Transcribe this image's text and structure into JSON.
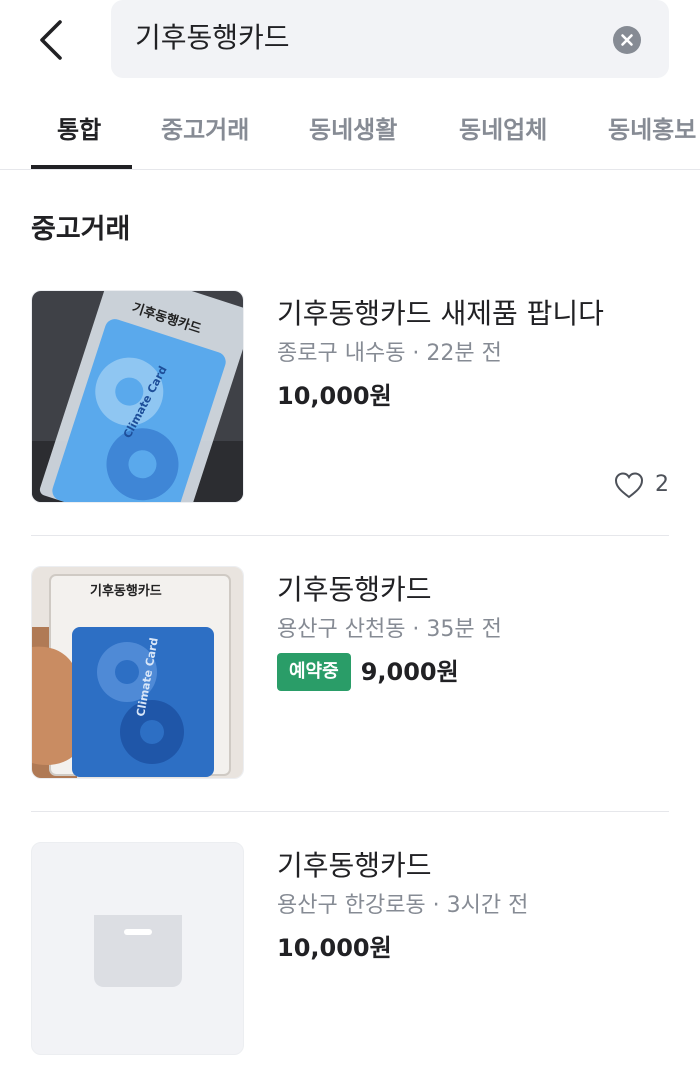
{
  "search": {
    "query": "기후동행카드"
  },
  "tabs": [
    {
      "label": "통합",
      "active": true
    },
    {
      "label": "중고거래",
      "active": false
    },
    {
      "label": "동네생활",
      "active": false
    },
    {
      "label": "동네업체",
      "active": false
    },
    {
      "label": "동네홍보",
      "active": false
    }
  ],
  "section": {
    "title": "중고거래"
  },
  "listings": [
    {
      "title": "기후동행카드 새제품 팝니다",
      "meta": "종로구 내수동 · 22분 전",
      "price": "10,000원",
      "likes": "2",
      "thumb_text": "기후동행카드",
      "card_text": "Climate Card"
    },
    {
      "title": "기후동행카드",
      "meta": "용산구 산천동 · 35분 전",
      "badge": "예약중",
      "price": "9,000원",
      "thumb_text": "기후동행카드",
      "card_text": "Climate Card"
    },
    {
      "title": "기후동행카드",
      "meta": "용산구 한강로동 · 3시간 전",
      "price": "10,000원",
      "thumb_icon": "placeholder-box-icon"
    }
  ],
  "colors": {
    "accent_green": "#2a9d68",
    "text_primary": "#212124",
    "text_secondary": "#868b94",
    "search_bg": "#f2f3f6"
  },
  "icons": {
    "back": "chevron-left-icon",
    "clear": "clear-icon",
    "like": "heart-outline-icon"
  }
}
